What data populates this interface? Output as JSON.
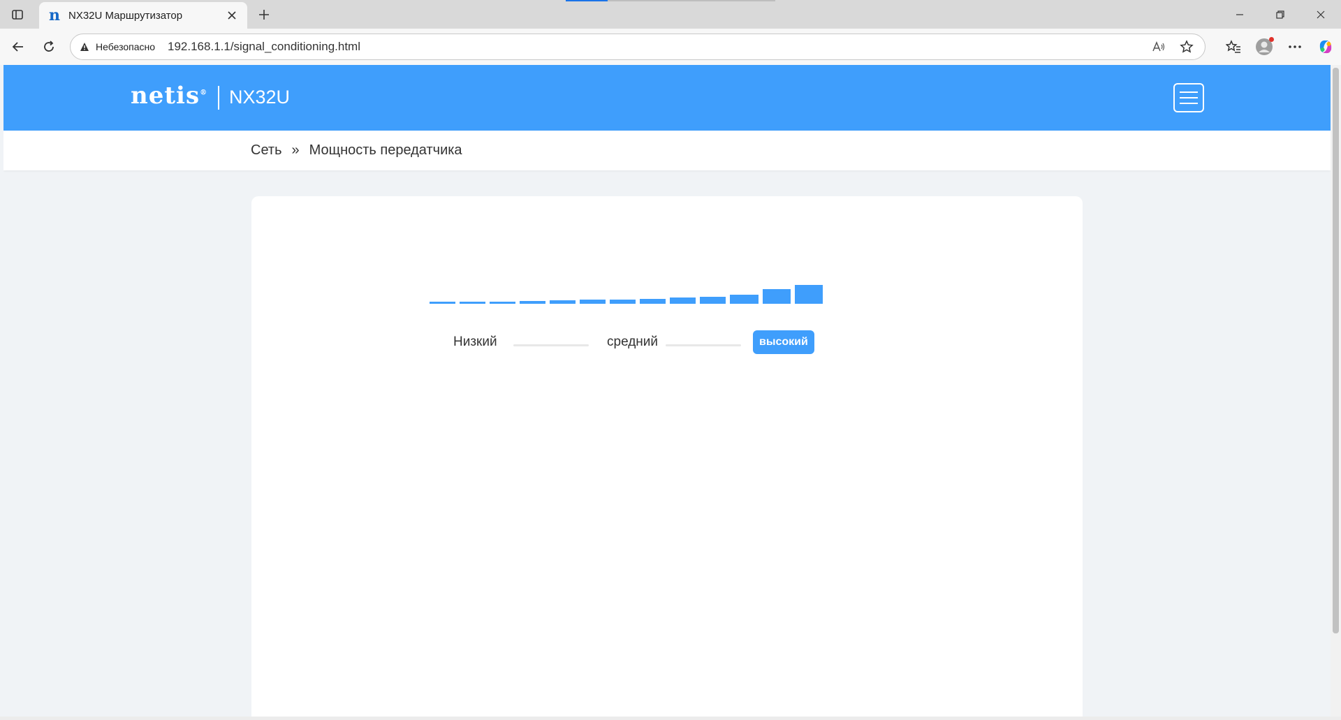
{
  "browser": {
    "tab_title": "NX32U Маршрутизатор",
    "security_label": "Небезопасно",
    "url": "192.168.1.1/signal_conditioning.html",
    "icons": {
      "tab_actions": "tab-actions-icon",
      "favicon": "n",
      "close": "close-icon",
      "new_tab": "plus-icon",
      "back": "back-arrow-icon",
      "reload": "reload-icon",
      "warning": "warning-icon",
      "read_aloud": "read-aloud-icon",
      "favorite": "star-icon",
      "favorites": "favorites-icon",
      "profile": "profile-icon",
      "more": "more-icon",
      "copilot": "copilot-icon"
    }
  },
  "header": {
    "logo": "netis",
    "logo_mark": "®",
    "model": "NX32U",
    "accent_color": "#3f9efc"
  },
  "breadcrumb": {
    "section": "Сеть",
    "separator": "»",
    "page": "Мощность передатчика"
  },
  "power": {
    "levels": [
      {
        "label": "Низкий",
        "active": false
      },
      {
        "label": "средний",
        "active": false
      },
      {
        "label": "высокий",
        "active": true
      }
    ],
    "bar_count": 13,
    "selected_level": "высокий"
  }
}
